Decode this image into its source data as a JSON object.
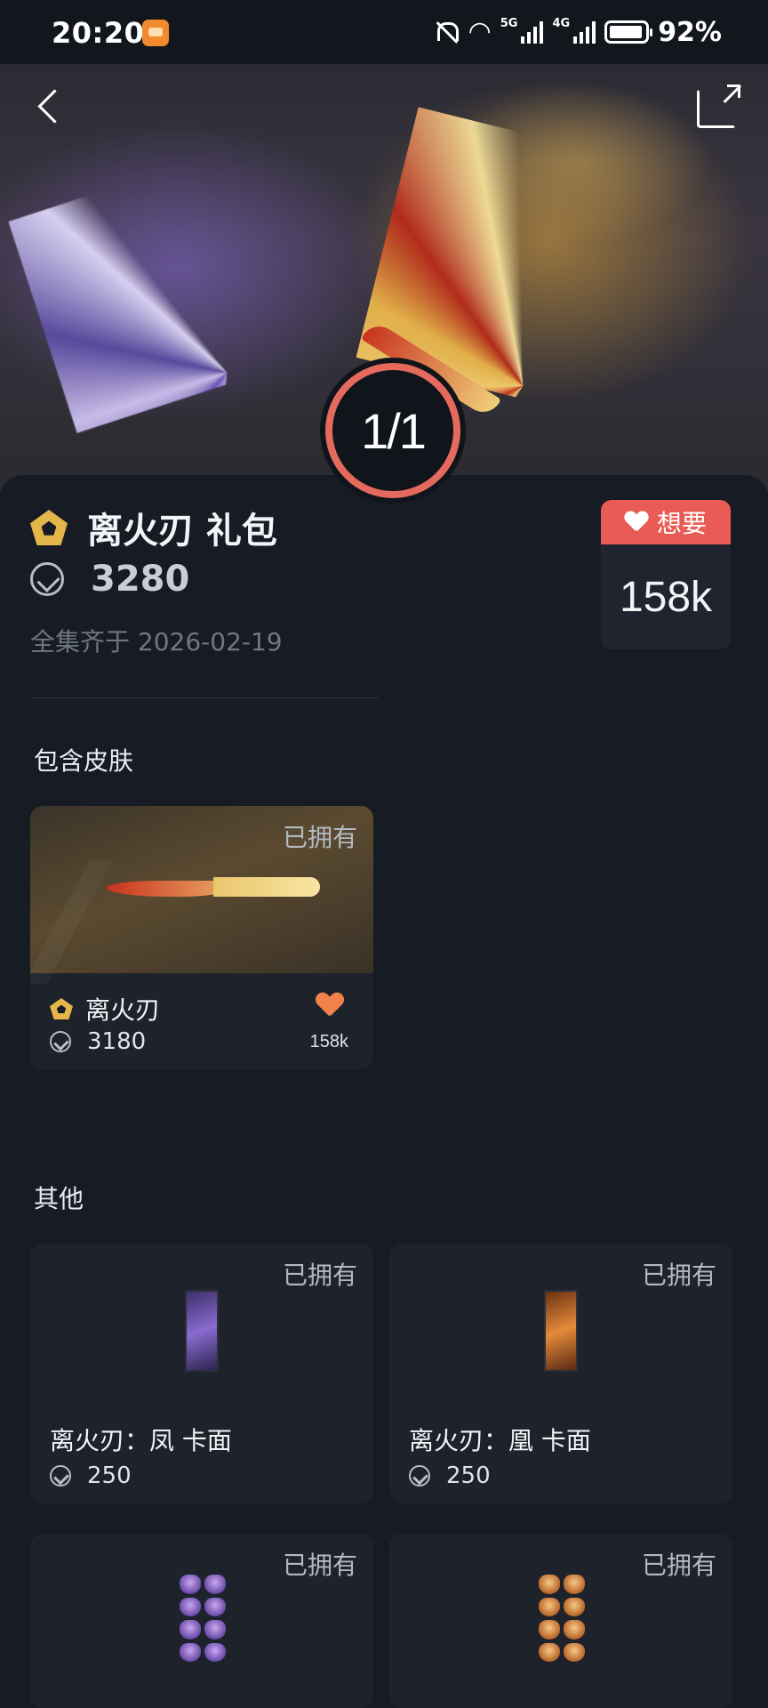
{
  "status_bar": {
    "time": "20:20",
    "network_5g": "5G",
    "network_4g": "4G",
    "battery_percent": "92%",
    "icons": [
      "app-notification-icon",
      "bell-muted-icon",
      "wifi-icon",
      "signal-5g-icon",
      "signal-4g-icon",
      "battery-icon"
    ]
  },
  "hero": {
    "page_indicator": "1/1",
    "icons": [
      "back-icon",
      "share-icon"
    ]
  },
  "bundle": {
    "name": "离火刃 礼包",
    "price": "3280",
    "release_date": "全集齐于 2026-02-19",
    "want_label": "想要",
    "want_count": "158k"
  },
  "sections": {
    "skins_title": "包含皮肤",
    "others_title": "其他"
  },
  "skins": [
    {
      "owned": "已拥有",
      "name": "离火刃",
      "price": "3180",
      "likes": "158k"
    }
  ],
  "others": [
    {
      "owned": "已拥有",
      "name": "离火刃：凤 卡面",
      "price": "250"
    },
    {
      "owned": "已拥有",
      "name": "离火刃：凰 卡面",
      "price": "250"
    },
    {
      "owned": "已拥有"
    },
    {
      "owned": "已拥有"
    }
  ],
  "colors": {
    "background": "#161b24",
    "card": "#1d222b",
    "accent_red": "#e95b55",
    "tier_gold": "#e4b64a",
    "heart_orange": "#f0824a"
  }
}
